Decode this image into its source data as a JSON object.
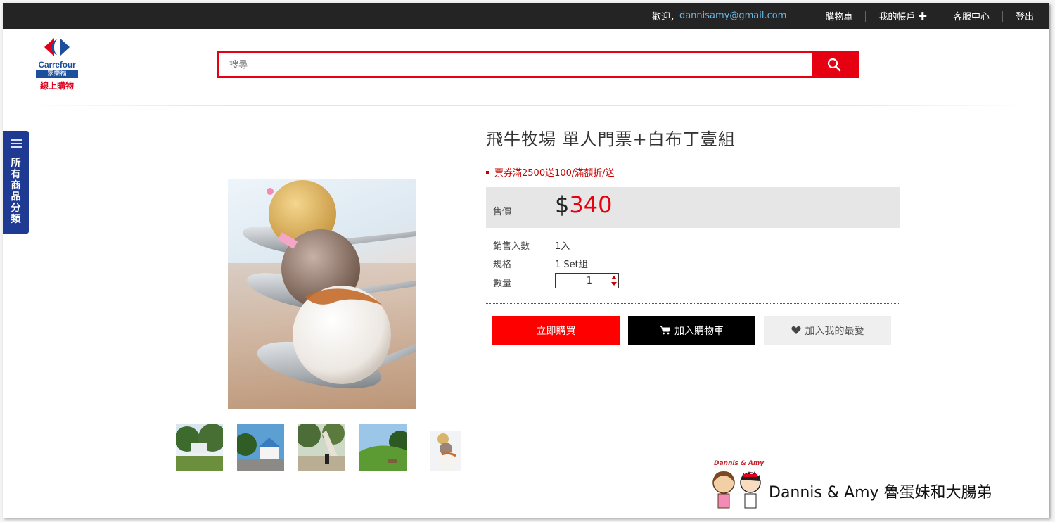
{
  "topbar": {
    "welcome_prefix": "歡迎，",
    "email": "dannisamy@gmail.com",
    "cart": "購物車",
    "account": "我的帳戶",
    "account_plus": "✚",
    "service": "客服中心",
    "logout": "登出"
  },
  "logo": {
    "brand": "Carrefour",
    "cn_name": "家樂福",
    "online": "線上購物"
  },
  "search": {
    "placeholder": "搜尋"
  },
  "category_tab": {
    "label": "所有商品分類"
  },
  "product": {
    "title": "飛牛牧場 單人門票+白布丁壹組",
    "promo": "票券滿2500送100/滿額折/送",
    "price_label": "售價",
    "currency": "$",
    "price": "340",
    "specs": [
      {
        "key": "銷售入數",
        "value": "1入"
      },
      {
        "key": "規格",
        "value": "1 Set組"
      },
      {
        "key": "數量",
        "value": "1"
      }
    ]
  },
  "actions": {
    "buy_now": "立即購買",
    "add_cart": "加入購物車",
    "add_fav": "加入我的最愛"
  },
  "watermark": {
    "small": "Dannis & Amy",
    "text": "Dannis & Amy 魯蛋妹和大腸弟"
  },
  "colors": {
    "accent_red": "#e50012",
    "topbar": "#242424",
    "category_blue": "#1f3a93",
    "email_link": "#67b6e6"
  }
}
